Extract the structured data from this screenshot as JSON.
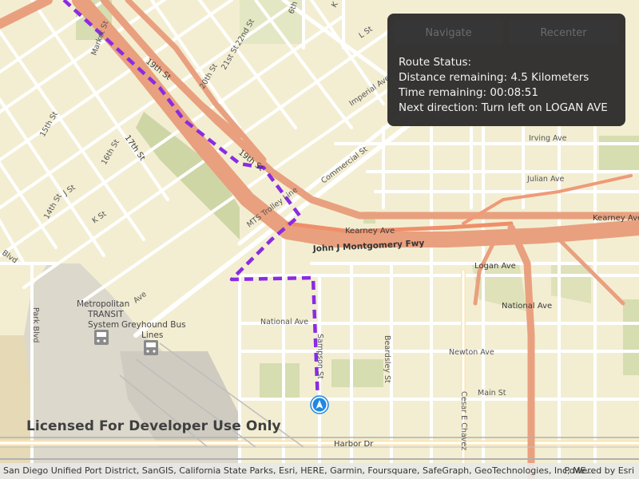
{
  "map": {
    "labels": {
      "market_st": "Market St",
      "nineteenth_st_a": "19th St",
      "nineteenth_st_b": "19th St",
      "seventeenth_st": "17th St",
      "twentysecond_st": "22nd St",
      "twentyfirst_st": "21st St",
      "twentieth_st": "20th St",
      "fifteenth_st": "15th St",
      "sixteenth_st": "16th St",
      "fourteenth_st": "14th St",
      "j_st": "J St",
      "k_st": "K St",
      "l_st": "L St",
      "imperial_ave": "Imperial Ave",
      "commercial_st": "Commercial St",
      "irving_ave": "Irving Ave",
      "julian_ave": "Julian Ave",
      "kearney_ave_1": "Kearney Ave",
      "kearney_ave_2": "Kearney Ave",
      "fwy": "John J Montgomery Fwy",
      "logan_ave": "Logan Ave",
      "national_ave_1": "National Ave",
      "national_ave_2": "National Ave",
      "newton_ave": "Newton Ave",
      "main_st": "Main St",
      "harbor_dr": "Harbor Dr",
      "beardsley_st": "Beardsley St",
      "cesar_chavez": "Cesar E Chavez",
      "park_blvd": "Park Blvd",
      "blvd": "Blvd",
      "sampson_st": "Sampson St",
      "mts_trolley": "MTS Trolley Line",
      "sixth_st": "6th St",
      "k_top": "K",
      "transit_line1": "Metropolitan",
      "transit_line2": "TRANSIT",
      "transit_line3": "System",
      "greyhound_line1": "Greyhound Bus",
      "greyhound_line2": "Lines",
      "ave": "Ave"
    },
    "icons": [
      "location-arrow-icon",
      "bus-icon",
      "bus-icon"
    ],
    "colors": {
      "background": "#f3eed2",
      "freeway": "#e9a07f",
      "route": "#8a2be2",
      "park": "#d8dfb4",
      "industrial": "#dcd8cc",
      "location": "#1e88e5"
    }
  },
  "panel": {
    "navigate_label": "Navigate",
    "recenter_label": "Recenter",
    "status_title": "Route Status:",
    "distance": "Distance remaining: 4.5 Kilometers",
    "time": "Time remaining: 00:08:51",
    "direction": "Next direction: Turn left on LOGAN AVE"
  },
  "watermark": "Licensed For Developer Use Only",
  "attribution": {
    "text": "San Diego Unified Port District, SanGIS, California State Parks, Esri, HERE, Garmin, Foursquare, SafeGraph, GeoTechnologies, Inc, ME...",
    "powered": "Powered by Esri"
  }
}
